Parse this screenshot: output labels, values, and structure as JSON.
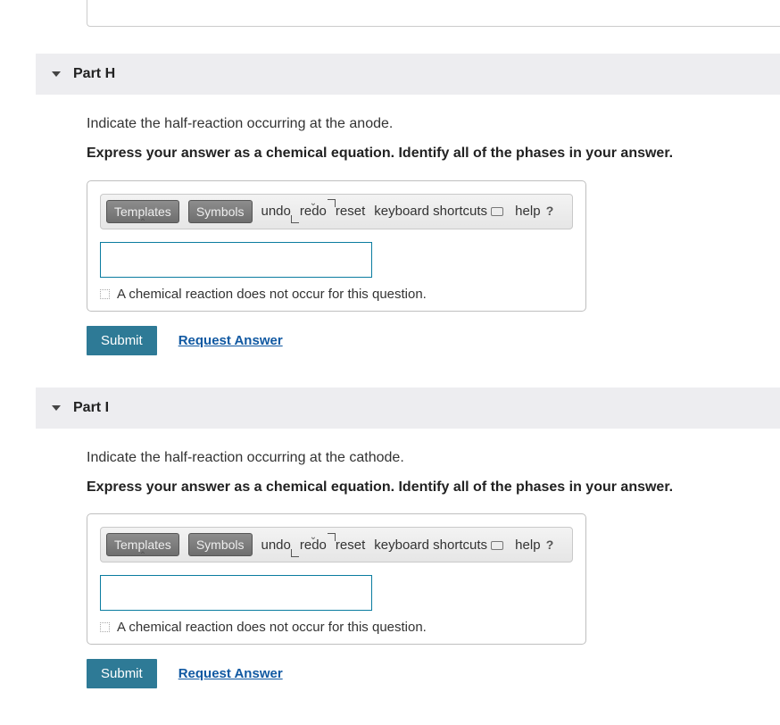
{
  "toolbar": {
    "templates": "Templates",
    "symbols": "Symbols",
    "undo": "undo",
    "redo": "redo",
    "reset": "reset",
    "keyboard": "keyboard shortcuts",
    "help": "help"
  },
  "common": {
    "no_reaction": "A chemical reaction does not occur for this question.",
    "submit": "Submit",
    "request": "Request Answer"
  },
  "partH": {
    "title": "Part H",
    "prompt": "Indicate the half-reaction occurring at the anode.",
    "instruction": "Express your answer as a chemical equation. Identify all of the phases in your answer."
  },
  "partI": {
    "title": "Part I",
    "prompt": "Indicate the half-reaction occurring at the cathode.",
    "instruction": "Express your answer as a chemical equation. Identify all of the phases in your answer."
  }
}
